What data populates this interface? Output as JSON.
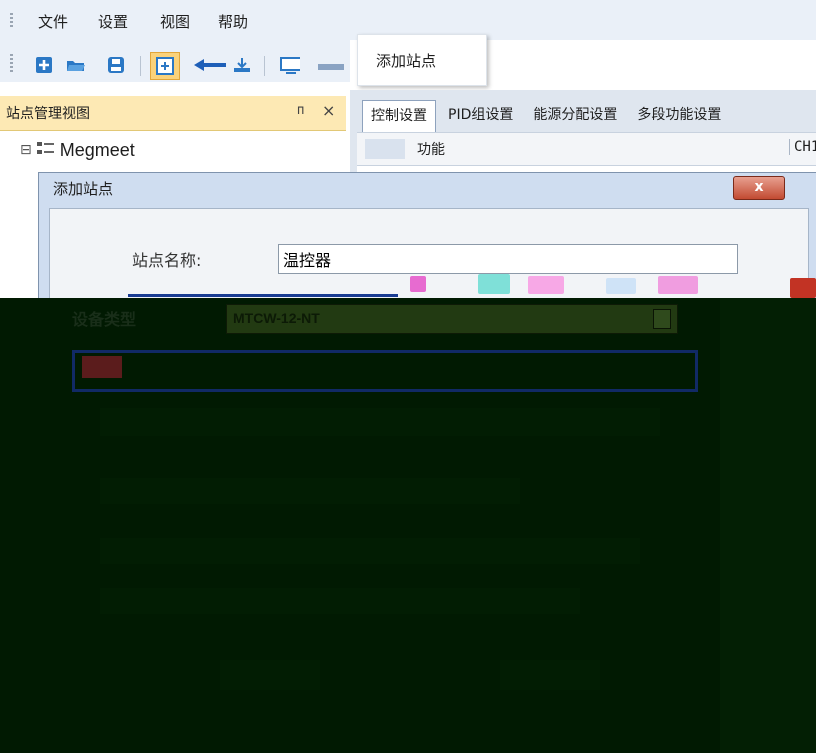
{
  "menubar": {
    "items": [
      "文件",
      "设置",
      "视图",
      "帮助"
    ]
  },
  "toolbar": {
    "buttons": [
      "new-icon",
      "open-folder-icon",
      "save-icon",
      "add-station-icon",
      "upload-icon",
      "download-icon",
      "monitor-icon"
    ]
  },
  "tooltip": {
    "text": "添加站点"
  },
  "left_panel": {
    "title": "站点管理视图",
    "pin_glyph": "ᴨ",
    "close_glyph": "×",
    "tree": {
      "expander": "⊟",
      "root_label": "Megmeet"
    }
  },
  "tabs": [
    "控制设置",
    "PID组设置",
    "能源分配设置",
    "多段功能设置"
  ],
  "grid": {
    "columns": [
      "功能",
      "CH1"
    ]
  },
  "dialog": {
    "title": "添加站点",
    "close_label": "x",
    "station_name_label": "站点名称:",
    "station_name_value": "温控器",
    "device_type_label": "设备类型",
    "device_type_value": "MTCW-12-NT"
  },
  "colors": {
    "menu_bg": "#eaf0f8",
    "panel_header_bg": "#fde9b4",
    "dialog_frame": "#cfddf0",
    "dark_overlay": "#011a02",
    "close_button": "#c24a32"
  }
}
